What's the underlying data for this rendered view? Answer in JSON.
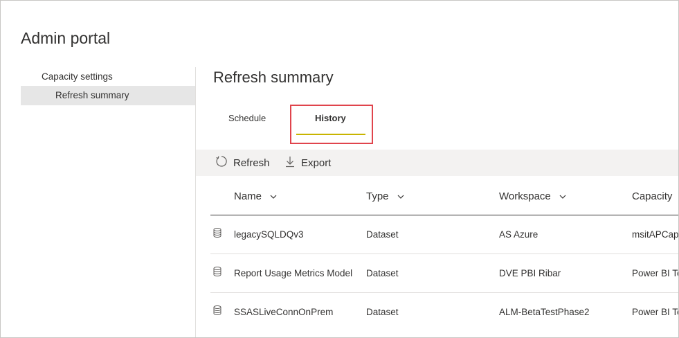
{
  "portal": {
    "title": "Admin portal"
  },
  "sidebar": {
    "items": [
      {
        "label": "Capacity settings"
      },
      {
        "label": "Refresh summary"
      }
    ]
  },
  "main": {
    "title": "Refresh summary",
    "tabs": [
      {
        "label": "Schedule",
        "selected": false
      },
      {
        "label": "History",
        "selected": true
      }
    ]
  },
  "toolbar": {
    "refresh_label": "Refresh",
    "export_label": "Export"
  },
  "table": {
    "columns": [
      {
        "label": "Name"
      },
      {
        "label": "Type"
      },
      {
        "label": "Workspace"
      },
      {
        "label": "Capacity"
      }
    ],
    "rows": [
      {
        "name": "legacySQLDQv3",
        "type": "Dataset",
        "workspace": "AS Azure",
        "capacity": "msitAPCap"
      },
      {
        "name": "Report Usage Metrics Model",
        "type": "Dataset",
        "workspace": "DVE PBI Ribar",
        "capacity": "Power BI Te"
      },
      {
        "name": "SSASLiveConnOnPrem",
        "type": "Dataset",
        "workspace": "ALM-BetaTestPhase2",
        "capacity": "Power BI Te"
      }
    ]
  },
  "colors": {
    "tab_underline": "#c8b400",
    "highlight_border": "#e0444c",
    "toolbar_bg": "#f3f2f1",
    "sidebar_selected_bg": "#e6e6e6"
  },
  "icons": {
    "refresh": "refresh-icon",
    "export": "download-arrow-icon",
    "dataset": "database-icon",
    "sort": "chevron-down-icon"
  }
}
